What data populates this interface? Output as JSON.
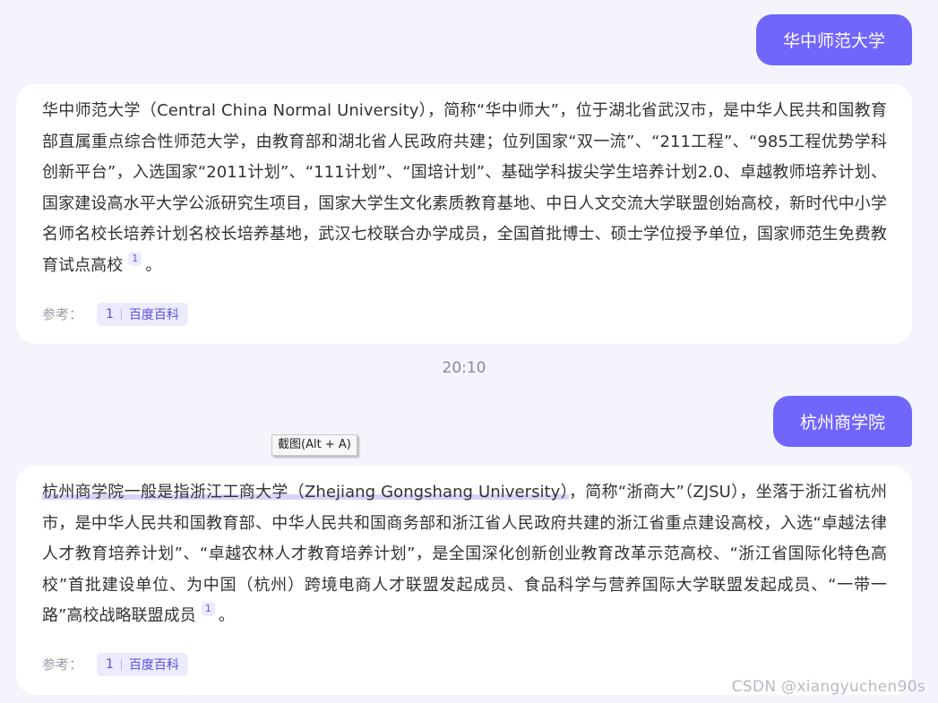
{
  "messages": [
    {
      "user": "华中师范大学",
      "answer": "华中师范大学（Central China Normal University），简称“华中师大”，位于湖北省武汉市，是中华人民共和国教育部直属重点综合性师范大学，由教育部和湖北省人民政府共建；位列国家“双一流”、“211工程”、“985工程优势学科创新平台”，入选国家“2011计划”、“111计划”、“国培计划”、基础学科拔尖学生培养计划2.0、卓越教师培养计划、国家建设高水平大学公派研究生项目，国家大学生文化素质教育基地、中日人文交流大学联盟创始高校，新时代中小学名师名校长培养计划名校长培养基地，武汉七校联合办学成员，全国首批博士、硕士学位授予单位，国家师范生免费教育试点高校",
      "cite": "1",
      "end": "。",
      "ref_label": "参考：",
      "ref_num": "1",
      "ref_source": "百度百科"
    },
    {
      "user": "杭州商学院",
      "answer_selected": "杭州商学院一般是指浙江工商大学（Zhejiang Gongshang University）",
      "answer": "，简称“浙商大”（ZJSU），坐落于浙江省杭州市，是中华人民共和国教育部、中华人民共和国商务部和浙江省人民政府共建的浙江省重点建设高校，入选“卓越法律人才教育培养计划”、“卓越农林人才教育培养计划”，是全国深化创新创业教育改革示范高校、“浙江省国际化特色高校”首批建设单位、为中国（杭州）跨境电商人才联盟发起成员、食品科学与营养国际大学联盟发起成员、“一带一路”高校战略联盟成员",
      "cite": "1",
      "end": "。",
      "ref_label": "参考：",
      "ref_num": "1",
      "ref_source": "百度百科"
    }
  ],
  "timestamp": "20:10",
  "tooltip": "截图(Alt + A)",
  "watermark": "CSDN @xiangyuchen90s",
  "colors": {
    "accent": "#7066fb",
    "background": "#f4f5fc",
    "card": "#ffffff",
    "chip": "#eceafd"
  }
}
